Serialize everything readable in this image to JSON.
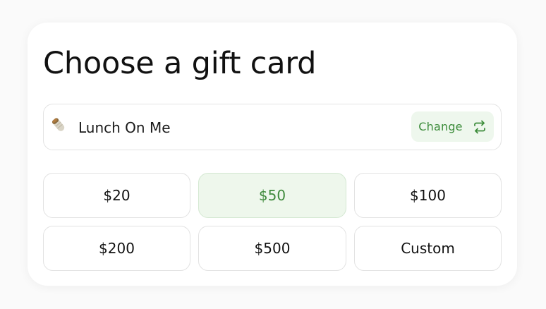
{
  "title": "Choose a gift card",
  "selected_card": {
    "icon": "burrito-icon",
    "name": "Lunch On Me",
    "change_label": "Change",
    "change_icon": "swap-arrows-icon"
  },
  "amounts": [
    {
      "label": "$20",
      "selected": false
    },
    {
      "label": "$50",
      "selected": true
    },
    {
      "label": "$100",
      "selected": false
    },
    {
      "label": "$200",
      "selected": false
    },
    {
      "label": "$500",
      "selected": false
    },
    {
      "label": "Custom",
      "selected": false
    }
  ],
  "colors": {
    "accent": "#3c8c3a",
    "accent_bg": "#eef7ed",
    "border": "#e3e3e3",
    "text": "#111111"
  }
}
